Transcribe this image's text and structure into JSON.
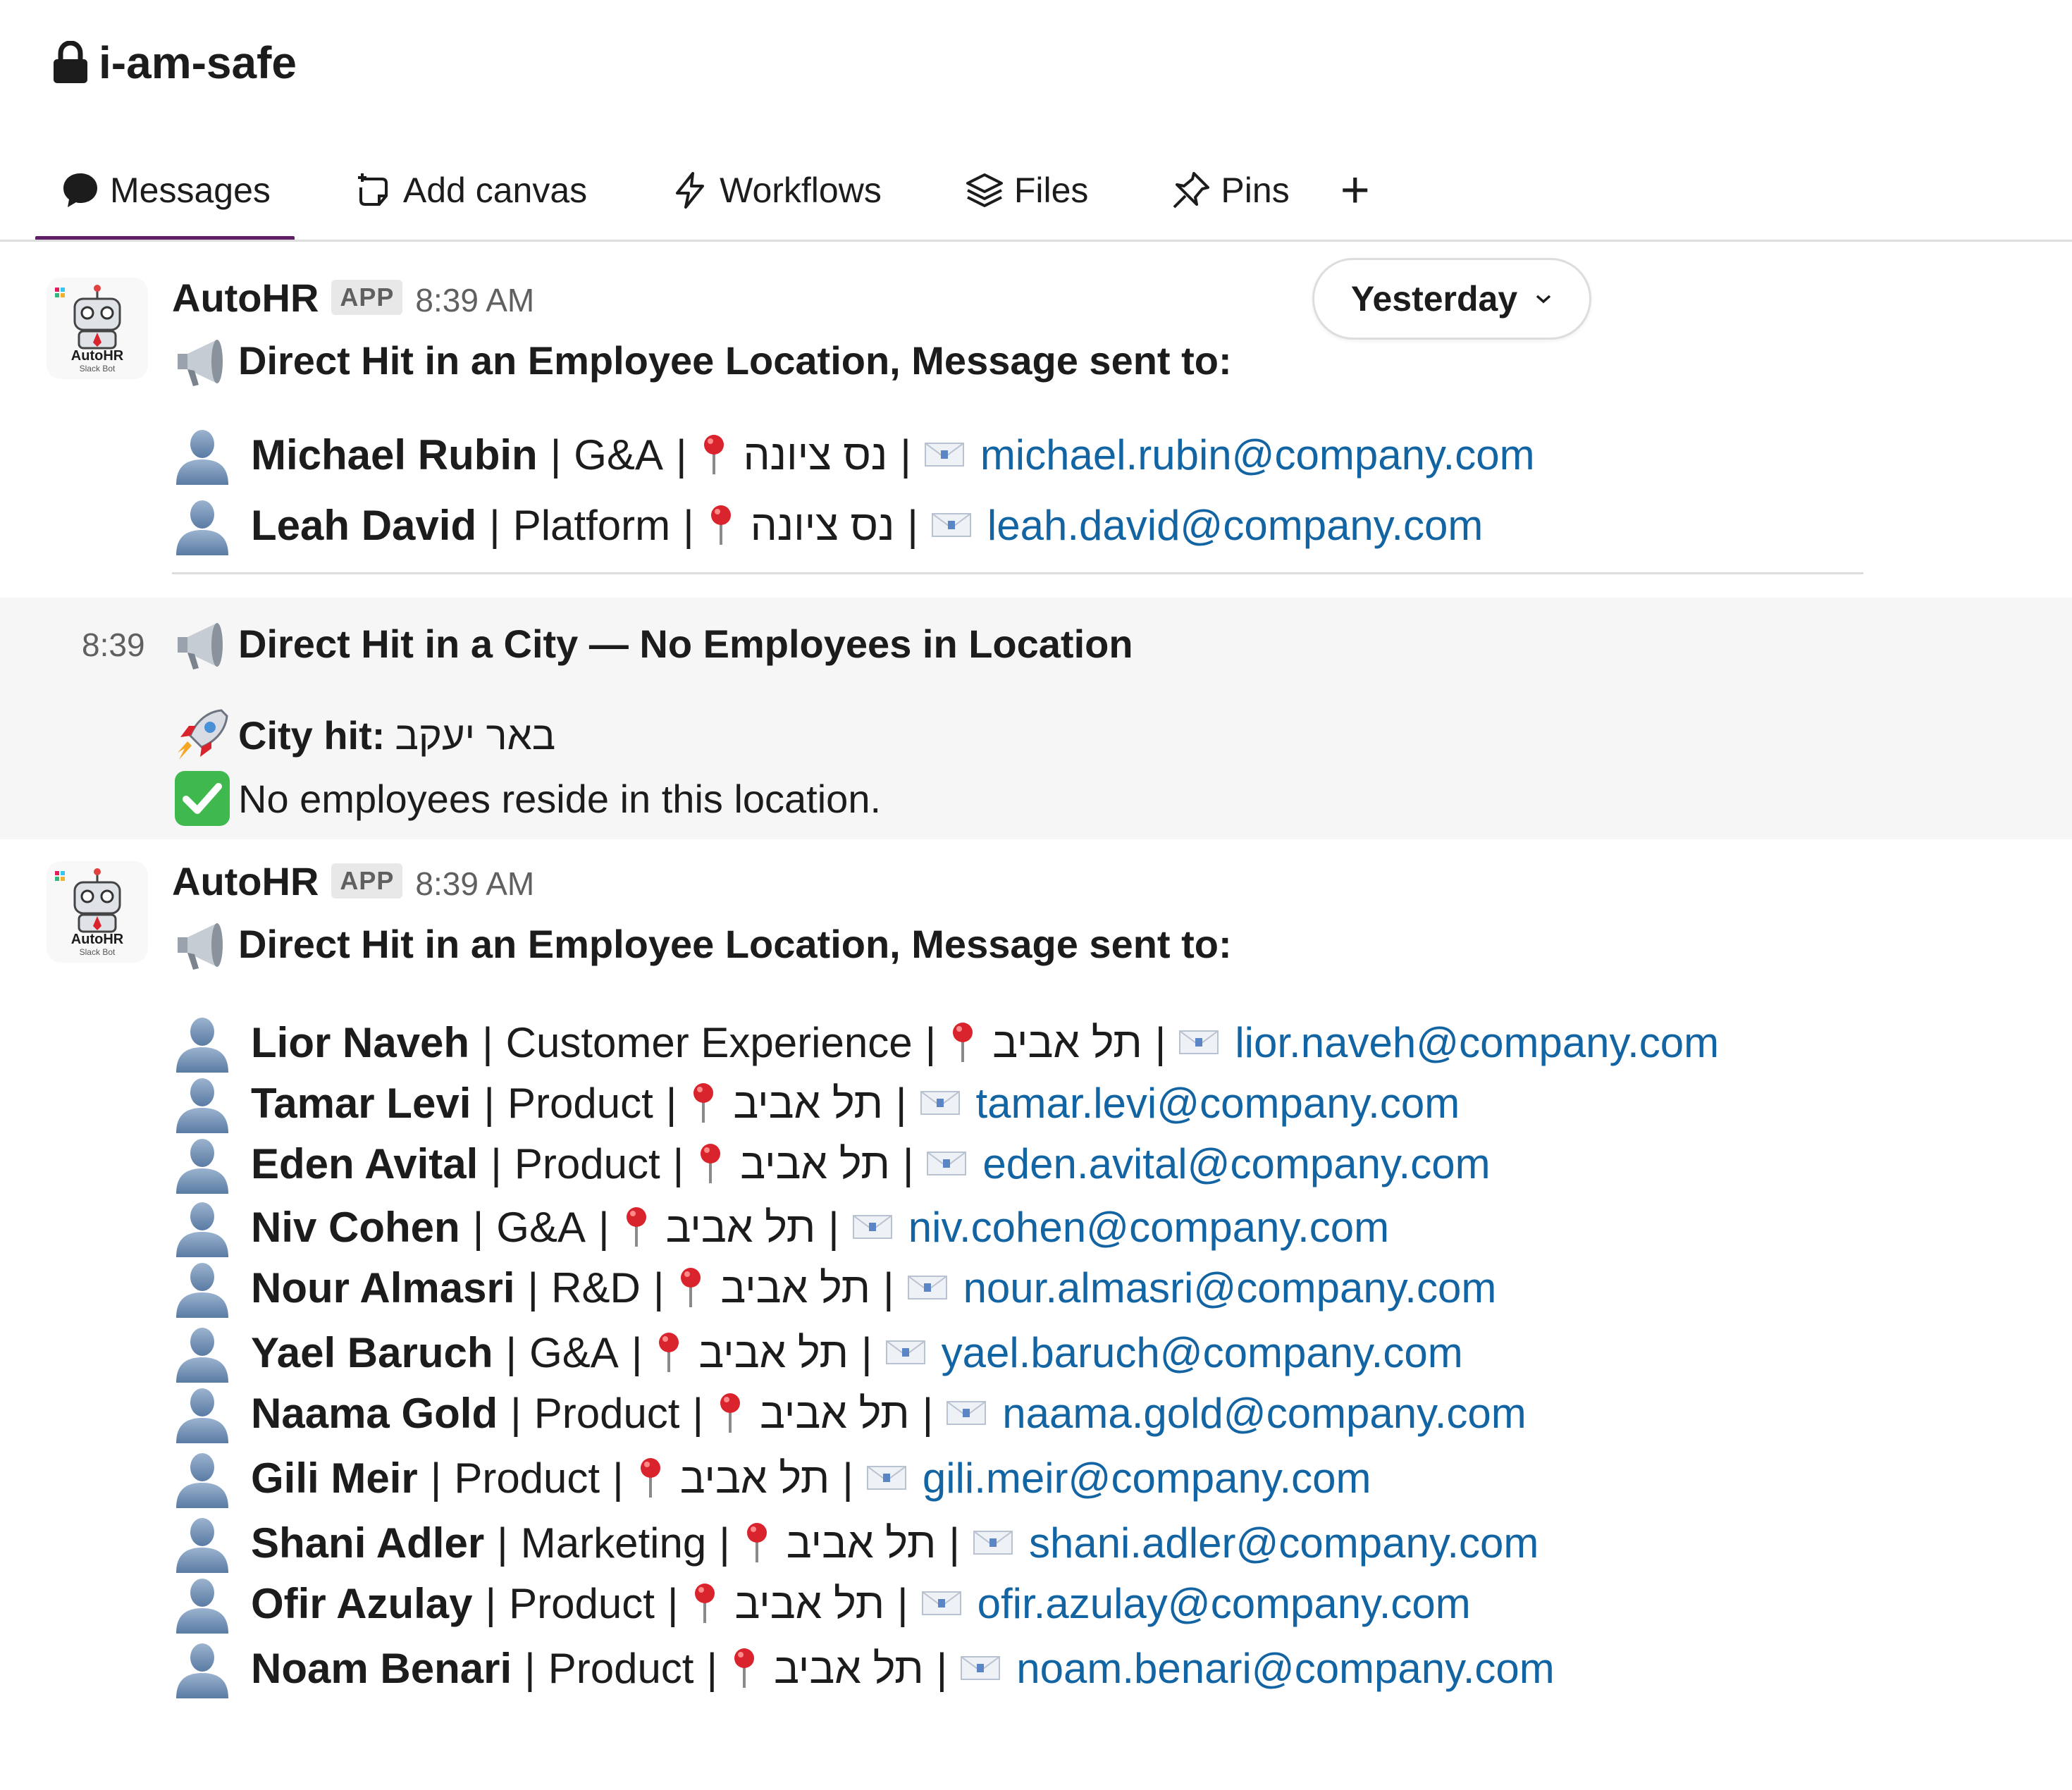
{
  "channel": {
    "name": "i-am-safe"
  },
  "tabs": [
    {
      "label": "Messages",
      "icon": "message-bubble-icon",
      "active": true
    },
    {
      "label": "Add canvas",
      "icon": "add-canvas-icon"
    },
    {
      "label": "Workflows",
      "icon": "lightning-icon"
    },
    {
      "label": "Files",
      "icon": "layers-icon"
    },
    {
      "label": "Pins",
      "icon": "pin-outline-icon"
    }
  ],
  "date_divider": {
    "label": "Yesterday"
  },
  "messages": [
    {
      "sender": "AutoHR",
      "badge": "APP",
      "time": "8:39 AM",
      "avatar_text": "AutoHR",
      "avatar_sub": "Slack Bot",
      "header": "Direct Hit in an Employee Location, Message sent to:",
      "employees": [
        {
          "name": "Michael Rubin",
          "dept": "G&A",
          "location": "נס ציונה",
          "email": "michael.rubin@company.com"
        },
        {
          "name": "Leah David",
          "dept": "Platform",
          "location": "נס ציונה",
          "email": "leah.david@company.com"
        }
      ]
    },
    {
      "time": "8:39",
      "header": "Direct Hit in a City — No Employees in Location",
      "city_label": "City hit:",
      "city": "באר יעקב",
      "status": "No employees reside in this location."
    },
    {
      "sender": "AutoHR",
      "badge": "APP",
      "time": "8:39 AM",
      "avatar_text": "AutoHR",
      "avatar_sub": "Slack Bot",
      "header": "Direct Hit in an Employee Location, Message sent to:",
      "employees": [
        {
          "name": "Lior Naveh",
          "dept": "Customer Experience",
          "location": "תל אביב",
          "email": "lior.naveh@company.com"
        },
        {
          "name": "Tamar Levi",
          "dept": "Product",
          "location": "תל אביב",
          "email": "tamar.levi@company.com"
        },
        {
          "name": "Eden Avital",
          "dept": "Product",
          "location": "תל אביב",
          "email": "eden.avital@company.com"
        },
        {
          "name": "Niv Cohen",
          "dept": "G&A",
          "location": "תל אביב",
          "email": "niv.cohen@company.com"
        },
        {
          "name": "Nour Almasri",
          "dept": "R&D",
          "location": "תל אביב",
          "email": "nour.almasri@company.com"
        },
        {
          "name": "Yael Baruch",
          "dept": "G&A",
          "location": "תל אביב",
          "email": "yael.baruch@company.com"
        },
        {
          "name": "Naama Gold",
          "dept": "Product",
          "location": "תל אביב",
          "email": "naama.gold@company.com"
        },
        {
          "name": "Gili Meir",
          "dept": "Product",
          "location": "תל אביב",
          "email": "gili.meir@company.com"
        },
        {
          "name": "Shani Adler",
          "dept": "Marketing",
          "location": "תל אביב",
          "email": "shani.adler@company.com"
        },
        {
          "name": "Ofir Azulay",
          "dept": "Product",
          "location": "תל אביב",
          "email": "ofir.azulay@company.com"
        },
        {
          "name": "Noam Benari",
          "dept": "Product",
          "location": "תל אביב",
          "email": "noam.benari@company.com"
        }
      ]
    }
  ]
}
